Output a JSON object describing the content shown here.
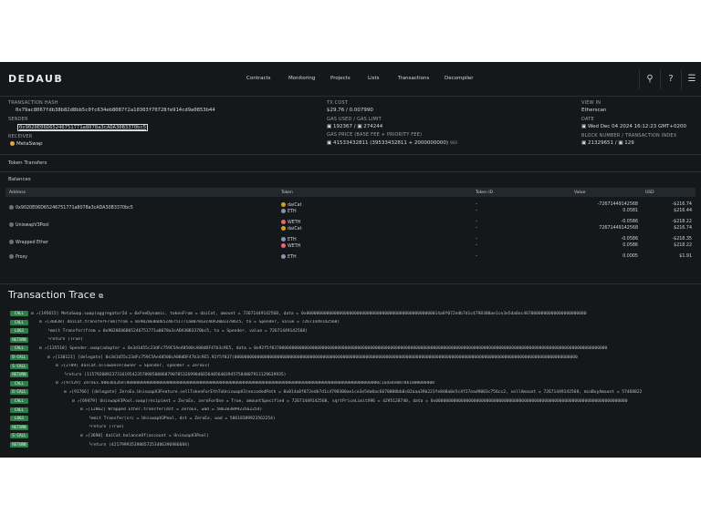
{
  "app": {
    "logo": "DEDAUB"
  },
  "nav": [
    "Contracts",
    "Monitoring",
    "Projects",
    "Lists",
    "Transactions",
    "Decompiler"
  ],
  "nav_icons": [
    "search-icon",
    "help-icon",
    "menu-icon"
  ],
  "tx": {
    "hash_label": "TRANSACTION HASH",
    "hash": "0x79ac8067fdb38b82d8bb5c0fc634eb8087f2a10303f70728fe914cd9a0853b44",
    "sender_label": "SENDER",
    "sender": "0x9020E06D65246751771a8078a3cADA30B3370bc5",
    "receiver_label": "RECEIVER",
    "receiver": "MetaSwap",
    "cost_label": "TX COST",
    "cost": "$29.76 / 0.007990",
    "gas_label": "GAS USED / GAS LIMIT",
    "gas_used": "192367",
    "gas_limit": "274244",
    "gas_price_label": "GAS PRICE (BASE FEE + PRIORITY FEE)",
    "gas_price": "41533432811 (39533432811 + 2000000000)",
    "gas_price_unit": "WEI",
    "view_label": "VIEW IN",
    "view": "Etherscan",
    "date_label": "DATE",
    "date": "Wed Dec 04 2024 16:12:23 GMT+0200",
    "block_label": "BLOCK NUMBER / TRANSACTION INDEX",
    "block": "21329651",
    "index": "129"
  },
  "token_transfers_label": "Token Transfers",
  "balances_label": "Balances",
  "balances_headers": [
    "Address",
    "Token",
    "Token ID",
    "Value",
    "USD"
  ],
  "balances": [
    {
      "address": "0x9020E06D65246751771a8078a3cADA30B3370bc5",
      "rows": [
        {
          "token": "daiCat",
          "id": "-",
          "value": "-72671449142568",
          "usd": "-$216.74"
        },
        {
          "token": "ETH",
          "id": "-",
          "value": "0.0581",
          "usd": "$216.44"
        }
      ]
    },
    {
      "address": "UniswapV3Pool",
      "rows": [
        {
          "token": "WETH",
          "id": "-",
          "value": "-0.0586",
          "usd": "-$218.22"
        },
        {
          "token": "daiCat",
          "id": "-",
          "value": "72671449142568",
          "usd": "$216.74"
        }
      ]
    },
    {
      "address": "Wrapped Ether",
      "rows": [
        {
          "token": "ETH",
          "id": "-",
          "value": "-0.0586",
          "usd": "-$218.35"
        },
        {
          "token": "WETH",
          "id": "-",
          "value": "0.0586",
          "usd": "$218.22"
        }
      ]
    },
    {
      "address": "Proxy",
      "rows": [
        {
          "token": "ETH",
          "id": "-",
          "value": "0.0005",
          "usd": "$1.91"
        }
      ]
    }
  ],
  "trace_title": "Transaction Trace",
  "trace": [
    {
      "op": "CALL",
      "indent": 0,
      "text": "[195615] MetaSwap.swap(aggregatorId = 0xFeeDynamic, tokenFrom = daiCat, amount = 72671449142568, data = 0x00000000000000000000000000000000000000000000000000014a8f072edb7d1c4798300ae1ce3e5da0ac4670000000000000000000000"
    },
    {
      "op": "CALL",
      "indent": 1,
      "text": "[36838] daiCat.transferFrom(from = 0x9020E06D65246751771a8078a3cADA30B3370bc5, to = Spender, value = 72671449142568)"
    },
    {
      "op": "LOG3",
      "indent": 2,
      "text": "emit Transfer(from = 0x9020E06D65246751771a8078a3cADA30B3370bc5, to = Spender, value = 72671449142568)"
    },
    {
      "op": "RETURN",
      "indent": 2,
      "text": "return (True)"
    },
    {
      "op": "CALL",
      "indent": 1,
      "text": "[135510] Spender.swap(adapter = 0x3d1d55c23dFc759C5Ae48500cA08dDF47b3c9E5, data = 0x92f5f0370000000000000000000000000000000000000000000000000000000000000000000000000000000000000000000000000000000000000000000000000000000000"
    },
    {
      "op": "D-CALL",
      "indent": 2,
      "text": "[130121] [delegate] 0x3d1d55c23dFc759C5Ae48500cA08dDF47b3c9E5.92f5f037(0000000000000000000000000000000000000000000000000000000000000000000000000000000000000000000000000000000000000000000000000000000000000000"
    },
    {
      "op": "S-CALL",
      "indent": 3,
      "text": "[2709] daiCat.allowance(owner = Spender, spender = ZeroEx)"
    },
    {
      "op": "RETURN",
      "indent": 4,
      "text": "return (115792089237316195423570985008687907853269984665640564039457584007913129639935)"
    },
    {
      "op": "CALL",
      "indent": 3,
      "text": "[97529] ZeroEx.0003ba2bd(0000000000000000000000000000000000000000000000000000000000000000000000000000000000000000000000000000c1ada4e0878b1000000000"
    },
    {
      "op": "D-CALL",
      "indent": 4,
      "text": "[91766] [delegate] ZeroEx.UniswapV3Feature.sellTokenForEthToUniswapV3(encodedPath = 0x014a8f072edb7d1c4798300ae1ce3e5da0ac6670000bb8c02aaa39b223fe8d0a0e5c4f27ead9083c756cc2, sellAmount = 72671449142568, minBuyAmount = 57468822"
    },
    {
      "op": "CALL",
      "indent": 5,
      "text": "[69479] UniswapV3Pool.swap(recipient = ZeroEx, zeroForOne = True, amountSpecified = 72671449142568, sqrtPriceLimitX96 = 4295128740, data = 0x0000000000000000000000000000000000000000000000000000000000000000000000000000"
    },
    {
      "op": "CALL",
      "indent": 6,
      "text": "[12862] Wrapped Ether.transfer(dst = ZeroEx, wad = 58618389923562254)"
    },
    {
      "op": "LOG3",
      "indent": 7,
      "text": "emit Transfer(src = UniswapV3Pool, dst = ZeroEx, wad = 58618389923562254)"
    },
    {
      "op": "RETURN",
      "indent": 7,
      "text": "return (True)"
    },
    {
      "op": "S-CALL",
      "indent": 6,
      "text": "[3690] daiCat.balanceOf(account = UniswapV3Pool)"
    },
    {
      "op": "RETURN",
      "indent": 7,
      "text": "return (421799935398057253406396986684)"
    }
  ],
  "colors": {
    "bg": "#15181b",
    "badge": "#2f7d47"
  }
}
